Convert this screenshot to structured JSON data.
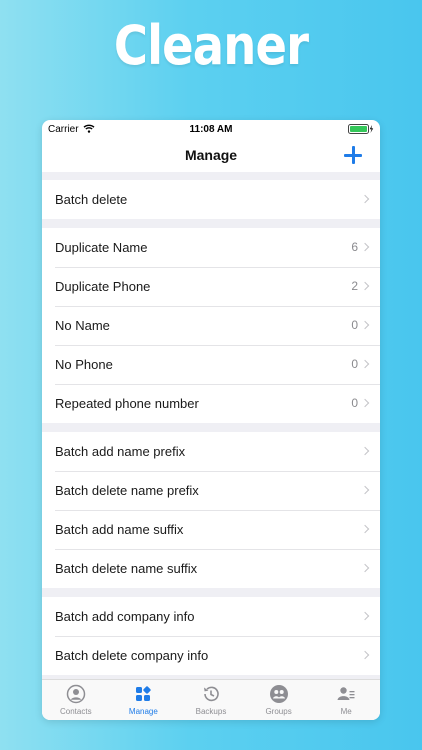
{
  "hero": {
    "title": "Cleaner"
  },
  "status_bar": {
    "carrier": "Carrier",
    "time": "11:08 AM"
  },
  "nav": {
    "title": "Manage",
    "add_icon": "plus-icon"
  },
  "colors": {
    "accent": "#1f7ce8",
    "background_gradient_start": "#8fe0f1",
    "background_gradient_end": "#49c6ee"
  },
  "groups": [
    {
      "items": [
        {
          "label": "Batch delete",
          "count": ""
        }
      ]
    },
    {
      "items": [
        {
          "label": "Duplicate Name",
          "count": "6"
        },
        {
          "label": "Duplicate Phone",
          "count": "2"
        },
        {
          "label": "No Name",
          "count": "0"
        },
        {
          "label": "No Phone",
          "count": "0"
        },
        {
          "label": "Repeated phone number",
          "count": "0"
        }
      ]
    },
    {
      "items": [
        {
          "label": "Batch add name prefix",
          "count": ""
        },
        {
          "label": "Batch delete name prefix",
          "count": ""
        },
        {
          "label": "Batch add name suffix",
          "count": ""
        },
        {
          "label": "Batch delete name suffix",
          "count": ""
        }
      ]
    },
    {
      "items": [
        {
          "label": "Batch add company info",
          "count": ""
        },
        {
          "label": "Batch delete company info",
          "count": ""
        }
      ]
    }
  ],
  "tabs": [
    {
      "label": "Contacts",
      "icon": "person-circle-icon",
      "active": false
    },
    {
      "label": "Manage",
      "icon": "grid-icon",
      "active": true
    },
    {
      "label": "Backups",
      "icon": "history-icon",
      "active": false
    },
    {
      "label": "Groups",
      "icon": "group-icon",
      "active": false
    },
    {
      "label": "Me",
      "icon": "profile-card-icon",
      "active": false
    }
  ]
}
